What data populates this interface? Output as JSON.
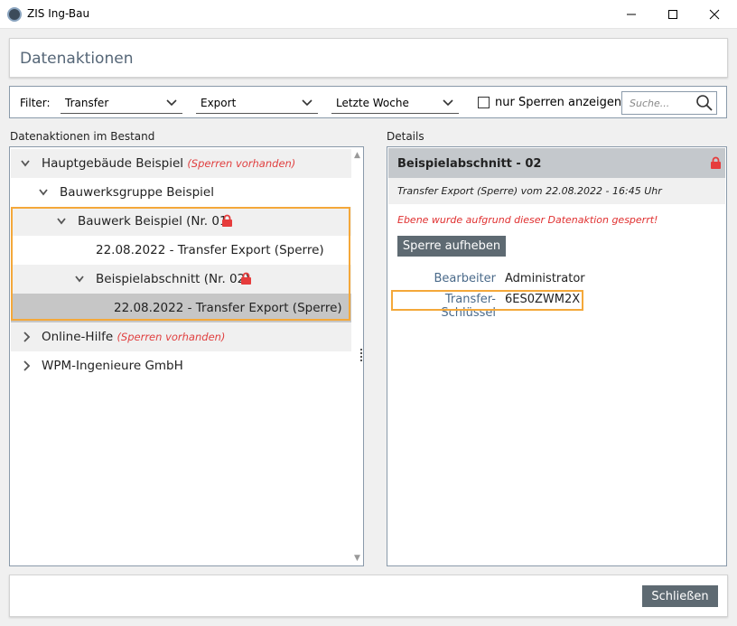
{
  "window": {
    "title": "ZIS Ing-Bau"
  },
  "header": {
    "title": "Datenaktionen"
  },
  "filter": {
    "label": "Filter:",
    "dropdown1": "Transfer",
    "dropdown2": "Export",
    "dropdown3": "Letzte Woche",
    "checkbox_label": "nur Sperren anzeigen",
    "search_placeholder": "Suche..."
  },
  "left": {
    "section_label": "Datenaktionen im Bestand",
    "rows": [
      {
        "label": "Hauptgebäude Beispiel",
        "note": "(Sperren vorhanden)"
      },
      {
        "label": "Bauwerksgruppe Beispiel"
      },
      {
        "label": "Bauwerk Beispiel (Nr. 01)"
      },
      {
        "label": "22.08.2022 - Transfer Export (Sperre)"
      },
      {
        "label": "Beispielabschnitt (Nr. 02)"
      },
      {
        "label": "22.08.2022 - Transfer Export (Sperre)"
      },
      {
        "label": "Online-Hilfe",
        "note": "(Sperren vorhanden)"
      },
      {
        "label": "WPM-Ingenieure GmbH"
      }
    ]
  },
  "details": {
    "section_label": "Details",
    "title": "Beispielabschnitt - 02",
    "subtitle": "Transfer Export (Sperre) vom 22.08.2022 - 16:45 Uhr",
    "warning": "Ebene wurde aufgrund dieser Datenaktion gesperrt!",
    "button": "Sperre aufheben",
    "fields": [
      {
        "key": "Bearbeiter",
        "value": "Administrator"
      },
      {
        "key": "Transfer-Schlüssel",
        "value": "6ES0ZWM2X"
      }
    ]
  },
  "footer": {
    "close_button": "Schließen"
  },
  "colors": {
    "accent": "#5e6a72",
    "highlight": "#f4a83a",
    "lock": "#e63c3c",
    "warning": "#e03030"
  },
  "icons": [
    "app-icon",
    "minimize-icon",
    "maximize-icon",
    "close-icon",
    "chevron-down-icon",
    "search-icon",
    "chevron-right-icon",
    "lock-icon"
  ]
}
